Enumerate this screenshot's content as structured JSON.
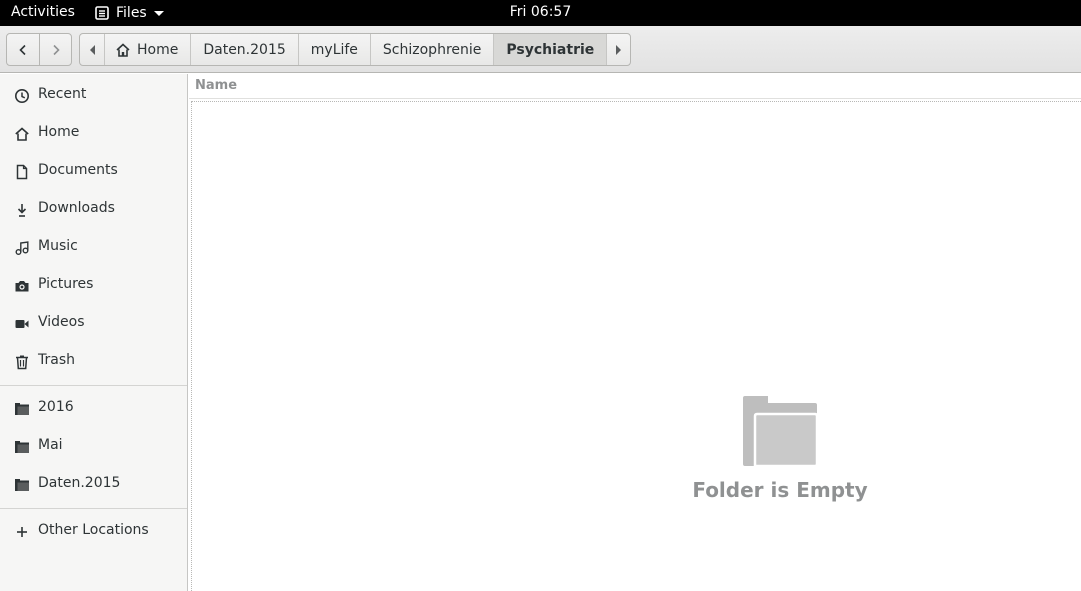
{
  "topbar": {
    "activities_label": "Activities",
    "app_name": "Files",
    "clock": "Fri 06:57"
  },
  "pathbar": {
    "segments": [
      {
        "label": "Home",
        "icon": "home-icon"
      },
      {
        "label": "Daten.2015"
      },
      {
        "label": "myLife"
      },
      {
        "label": "Schizophrenie"
      },
      {
        "label": "Psychiatrie",
        "active": true
      }
    ]
  },
  "sidebar": {
    "places": [
      {
        "label": "Recent",
        "icon": "clock-icon"
      },
      {
        "label": "Home",
        "icon": "home-icon"
      },
      {
        "label": "Documents",
        "icon": "document-icon"
      },
      {
        "label": "Downloads",
        "icon": "download-icon"
      },
      {
        "label": "Music",
        "icon": "music-icon"
      },
      {
        "label": "Pictures",
        "icon": "camera-icon"
      },
      {
        "label": "Videos",
        "icon": "video-icon"
      },
      {
        "label": "Trash",
        "icon": "trash-icon"
      }
    ],
    "bookmarks": [
      {
        "label": "2016",
        "icon": "folder-icon"
      },
      {
        "label": "Mai",
        "icon": "folder-icon"
      },
      {
        "label": "Daten.2015",
        "icon": "folder-icon"
      }
    ],
    "other_locations": {
      "label": "Other Locations",
      "icon": "plus-icon"
    }
  },
  "main": {
    "column_name": "Name",
    "empty_message": "Folder is Empty"
  },
  "colors": {
    "topbar_bg": "#000000",
    "sidebar_bg": "#f6f6f5",
    "empty_text": "#8f9192",
    "empty_icon": "#bebebe"
  }
}
